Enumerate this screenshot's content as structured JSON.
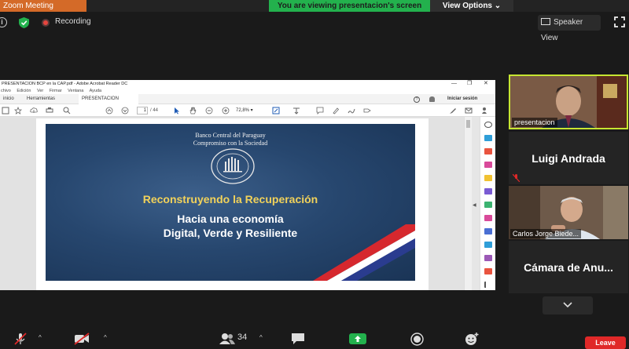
{
  "titlebar": {
    "app_title": "Zoom Meeting",
    "share_banner": "You are viewing presentacion's screen",
    "view_options": "View Options ⌄"
  },
  "topbar": {
    "info_glyph": "i",
    "recording_label": "Recording",
    "speaker_view_label": "Speaker View"
  },
  "acrobat": {
    "window_title": "PRESENTACION BCP en la CAP.pdf - Adobe Acrobat Reader DC",
    "window_controls": [
      "—",
      "❐",
      "✕"
    ],
    "menu": [
      "chivo",
      "Edición",
      "Ver",
      "Firmar",
      "Ventana",
      "Ayuda"
    ],
    "tabs": [
      "inicio",
      "Herramientas",
      "PRESENTACION BC..."
    ],
    "tab_close": "×",
    "help_glyph": "?",
    "signin_label": "Iniciar sesión",
    "page_current": "1",
    "page_total": "/ 44",
    "zoom": "72,8%  ▾"
  },
  "slide": {
    "bank_name": "Banco Central del Paraguay",
    "bank_tagline": "Compromiso con la Sociedad",
    "headline": "Reconstruyendo la Recuperación",
    "sub_line1": "Hacia una economía",
    "sub_line2": "Digital, Verde y Resiliente"
  },
  "participants": {
    "p1_name": "presentacion",
    "p2_name": "Luigi Andrada",
    "p3_name": "Carlos Jorge Biede...",
    "p4_name": "Cámara de Anu..."
  },
  "bottombar": {
    "caret": "^",
    "participant_count": "34",
    "leave_label": "Leave"
  },
  "colors": {
    "zoom_orange": "#d46a28",
    "share_green": "#23b14d",
    "leave_red": "#e02828",
    "headline_gold": "#f2d25a"
  }
}
